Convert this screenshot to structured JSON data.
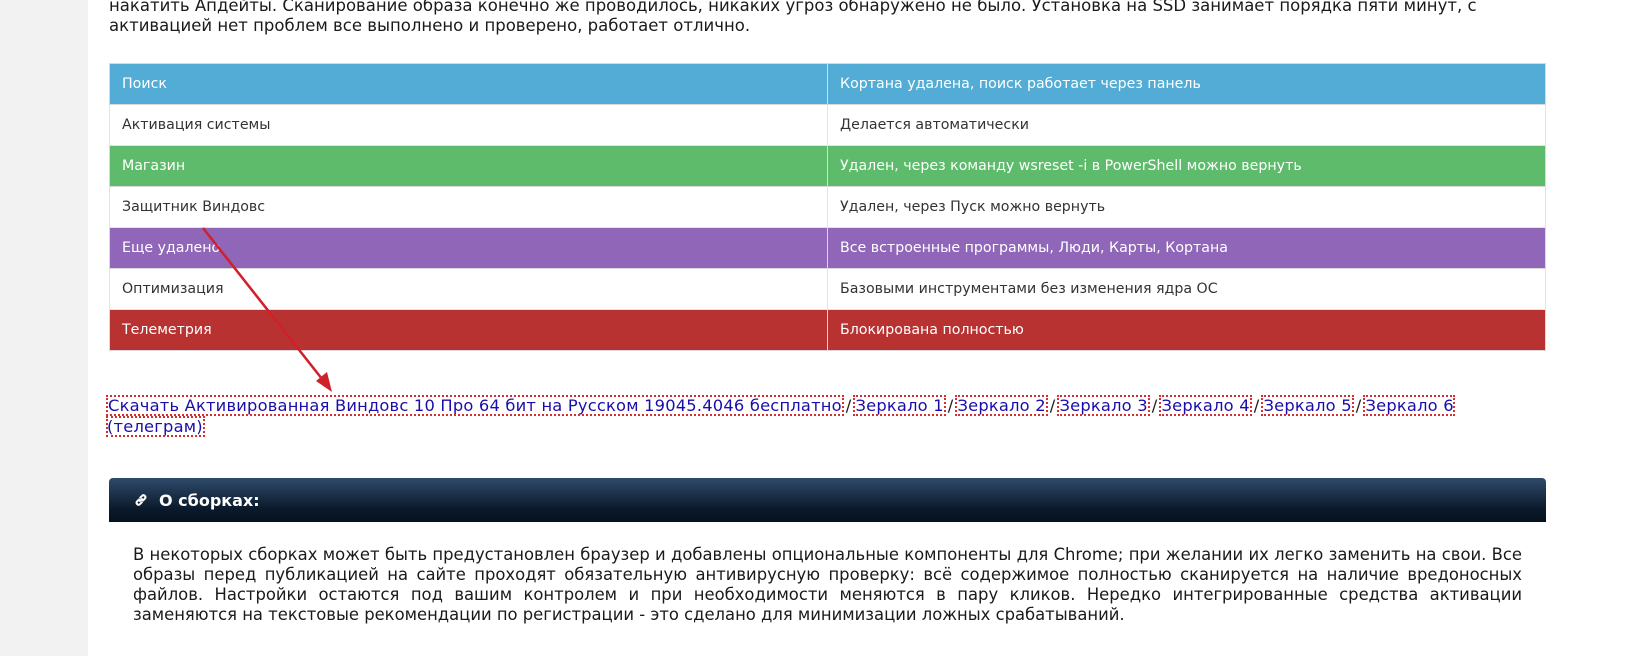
{
  "intro": {
    "line1": "накатить Апдейты. Сканирование образа конечно же проводилось, никаких угроз обнаружено не было. Установка на SSD занимает порядка пяти минут, с",
    "line2": "активацией нет проблем все выполнено и проверено, работает отлично."
  },
  "table": {
    "rows": [
      {
        "label": "Поиск",
        "value": "Кортана удалена, поиск работает через панель",
        "color": "#52acd5"
      },
      {
        "label": "Активация системы",
        "value": "Делается автоматически",
        "color": "#ffffff"
      },
      {
        "label": "Магазин",
        "value": "Удален, через команду wsreset -i в PowerShell можно вернуть",
        "color": "#5dbb6b"
      },
      {
        "label": "Защитник Виндовс",
        "value": "Удален, через Пуск можно вернуть",
        "color": "#ffffff"
      },
      {
        "label": "Еще удалено",
        "value": "Все встроенные программы, Люди, Карты, Кортана",
        "color": "#9066b8"
      },
      {
        "label": "Оптимизация",
        "value": "Базовыми инструментами без изменения ядра ОС",
        "color": "#ffffff"
      },
      {
        "label": "Телеметрия",
        "value": "Блокирована полностью",
        "color": "#b83232"
      }
    ]
  },
  "downloads": {
    "main": "Скачать Активированная Виндовс 10 Про 64 бит на Русском 19045.4046 бесплатно",
    "separator": "/",
    "mirrors": [
      "Зеркало 1",
      "Зеркало 2",
      "Зеркало 3",
      "Зеркало 4",
      "Зеркало 5",
      "Зеркало 6"
    ],
    "telegram": "(телеграм)"
  },
  "about": {
    "icon": "link-icon",
    "title": "О сборках:",
    "text": "В некоторых сборках может быть предустановлен браузер и добавлены опциональные компоненты для Chrome; при желании их легко заменить на свои. Все образы перед публикацией на сайте проходят обязательную антивирусную проверку: всё содержимое полностью сканируется на наличие вредоносных файлов. Настройки остаются под вашим контролем и при необходимости меняются в пару кликов. Нередко интегрированные средства активации заменяются на текстовые рекомендации по регистрации - это сделано для минимизации ложных срабатываний."
  },
  "colors": {
    "link": "#1a0dab",
    "arrow": "#d0202a",
    "header_dark": "#0b1a2b"
  }
}
